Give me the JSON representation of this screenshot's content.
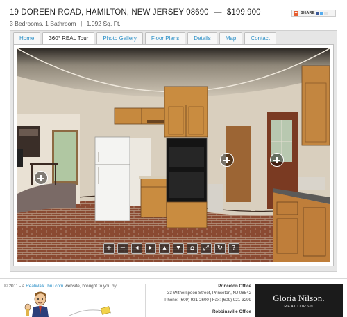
{
  "listing": {
    "address": "19 DOREEN ROAD, HAMILTON, NEW JERSEY 08690",
    "dash": "—",
    "price": "$199,900",
    "beds_baths": "3 Bedrooms, 1 Bathroom",
    "separator": "|",
    "sqft": "1,092 Sq. Ft."
  },
  "share": {
    "label": "SHARE"
  },
  "tabs": [
    {
      "label": "Home",
      "active": false
    },
    {
      "label": "360° REAL Tour",
      "active": true
    },
    {
      "label": "Photo Gallery",
      "active": false
    },
    {
      "label": "Floor Plans",
      "active": false
    },
    {
      "label": "Details",
      "active": false
    },
    {
      "label": "Map",
      "active": false
    },
    {
      "label": "Contact",
      "active": false
    }
  ],
  "controls": [
    {
      "name": "zoom-in",
      "glyph": "+"
    },
    {
      "name": "zoom-out",
      "glyph": "−"
    },
    {
      "name": "pan-left",
      "glyph": "◂"
    },
    {
      "name": "pan-right",
      "glyph": "▸"
    },
    {
      "name": "pan-up",
      "glyph": "▴"
    },
    {
      "name": "pan-down",
      "glyph": "▾"
    },
    {
      "name": "home",
      "glyph": "⌂"
    },
    {
      "name": "fullscreen",
      "glyph": "⤢"
    },
    {
      "name": "autorotate",
      "glyph": "↻"
    },
    {
      "name": "help",
      "glyph": "?"
    }
  ],
  "footer": {
    "copyright_prefix": "© 2011 - a ",
    "site_link": "RealWalkThru.com",
    "copyright_suffix": " website, brought to you by:",
    "office1": {
      "name": "Princeton Office",
      "address": "33 Witherspoon Street, Princeton, NJ 08542",
      "phone": "Phone: (609) 921-2600 | Fax: (609) 921-3299"
    },
    "office2": {
      "name": "Robbinsville Office"
    },
    "brand_name": "Gloria Nilson.",
    "brand_sub": "REALTORS®"
  },
  "colors": {
    "link": "#2a8fc7",
    "brand_bg": "#1b1b1b"
  }
}
